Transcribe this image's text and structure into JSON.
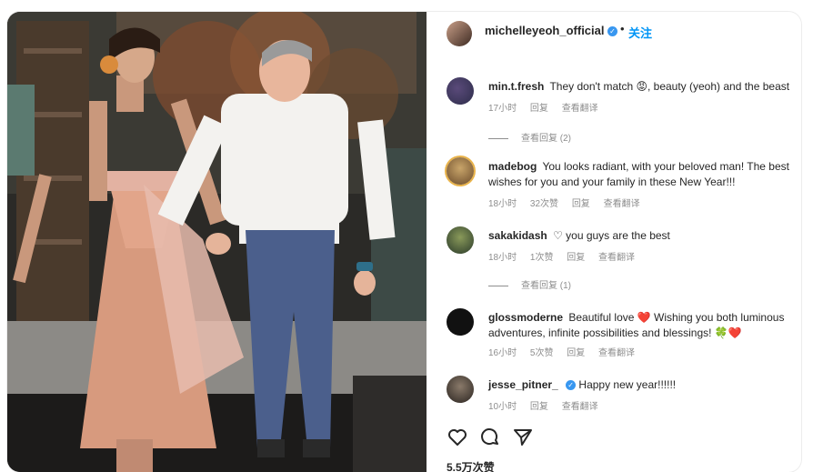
{
  "post": {
    "username": "michelleyeoh_official",
    "separator": "•",
    "follow_label": "关注",
    "likes_count": "5.5万次赞"
  },
  "comments": [
    {
      "username": "min.t.fresh",
      "text": "They don't match 😡, beauty (yeoh) and the beast",
      "time": "17小时",
      "likes": "",
      "reply_label": "回复",
      "translate_label": "查看翻译",
      "view_replies": "查看回复 (2)"
    },
    {
      "username": "madebog",
      "text": "You looks radiant, with your beloved man! The best wishes for you and your family in these New Year!!!",
      "time": "18小时",
      "likes": "32次赞",
      "reply_label": "回复",
      "translate_label": "查看翻译",
      "view_replies": ""
    },
    {
      "username": "sakakidash",
      "text": "♡ you guys are the best",
      "time": "18小时",
      "likes": "1次赞",
      "reply_label": "回复",
      "translate_label": "查看翻译",
      "view_replies": "查看回复 (1)"
    },
    {
      "username": "glossmoderne",
      "text": "Beautiful love ❤️ Wishing you both luminous adventures, infinite possibilities and blessings! 🍀❤️",
      "time": "16小时",
      "likes": "5次赞",
      "reply_label": "回复",
      "translate_label": "查看翻译",
      "view_replies": ""
    },
    {
      "username": "jesse_pitner_",
      "text": "Happy new year!!!!!!",
      "time": "10小时",
      "likes": "",
      "reply_label": "回复",
      "translate_label": "查看翻译",
      "view_replies": ""
    }
  ],
  "icons": {
    "like": "heart-icon",
    "comment": "comment-bubble-icon",
    "share": "paper-plane-icon",
    "verified": "verified-badge-icon"
  },
  "colors": {
    "link": "#0095f6",
    "verified": "#3897f0",
    "secondary_text": "#8e8e8e",
    "heart_red": "#e0245e"
  }
}
